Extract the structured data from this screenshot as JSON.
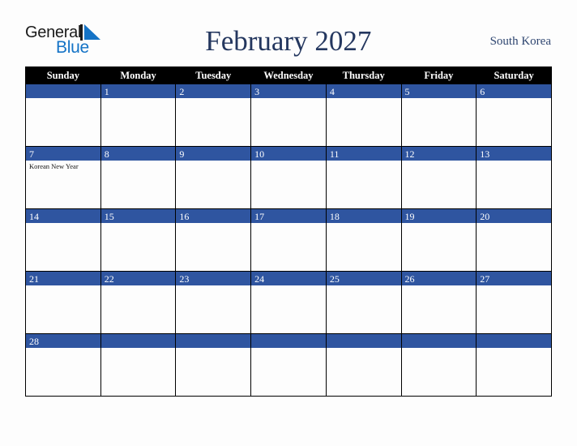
{
  "brand": {
    "name_part1": "General",
    "name_part2": "Blue",
    "mark_icon": "triangle-logo-icon",
    "primary_color": "#1473c6",
    "text_color": "#1b1b1b"
  },
  "header": {
    "title": "February 2027",
    "month": "February",
    "year": "2027",
    "region": "South Korea",
    "title_color": "#24375f"
  },
  "calendar": {
    "accent_color": "#2f55a0",
    "header_bg": "#000000",
    "header_fg": "#ffffff",
    "weekday_headers": [
      "Sunday",
      "Monday",
      "Tuesday",
      "Wednesday",
      "Thursday",
      "Friday",
      "Saturday"
    ],
    "weeks": [
      [
        {
          "day": "",
          "events": []
        },
        {
          "day": "1",
          "events": []
        },
        {
          "day": "2",
          "events": []
        },
        {
          "day": "3",
          "events": []
        },
        {
          "day": "4",
          "events": []
        },
        {
          "day": "5",
          "events": []
        },
        {
          "day": "6",
          "events": []
        }
      ],
      [
        {
          "day": "7",
          "events": [
            "Korean New Year"
          ]
        },
        {
          "day": "8",
          "events": []
        },
        {
          "day": "9",
          "events": []
        },
        {
          "day": "10",
          "events": []
        },
        {
          "day": "11",
          "events": []
        },
        {
          "day": "12",
          "events": []
        },
        {
          "day": "13",
          "events": []
        }
      ],
      [
        {
          "day": "14",
          "events": []
        },
        {
          "day": "15",
          "events": []
        },
        {
          "day": "16",
          "events": []
        },
        {
          "day": "17",
          "events": []
        },
        {
          "day": "18",
          "events": []
        },
        {
          "day": "19",
          "events": []
        },
        {
          "day": "20",
          "events": []
        }
      ],
      [
        {
          "day": "21",
          "events": []
        },
        {
          "day": "22",
          "events": []
        },
        {
          "day": "23",
          "events": []
        },
        {
          "day": "24",
          "events": []
        },
        {
          "day": "25",
          "events": []
        },
        {
          "day": "26",
          "events": []
        },
        {
          "day": "27",
          "events": []
        }
      ],
      [
        {
          "day": "28",
          "events": []
        },
        {
          "day": "",
          "events": []
        },
        {
          "day": "",
          "events": []
        },
        {
          "day": "",
          "events": []
        },
        {
          "day": "",
          "events": []
        },
        {
          "day": "",
          "events": []
        },
        {
          "day": "",
          "events": []
        }
      ]
    ]
  }
}
